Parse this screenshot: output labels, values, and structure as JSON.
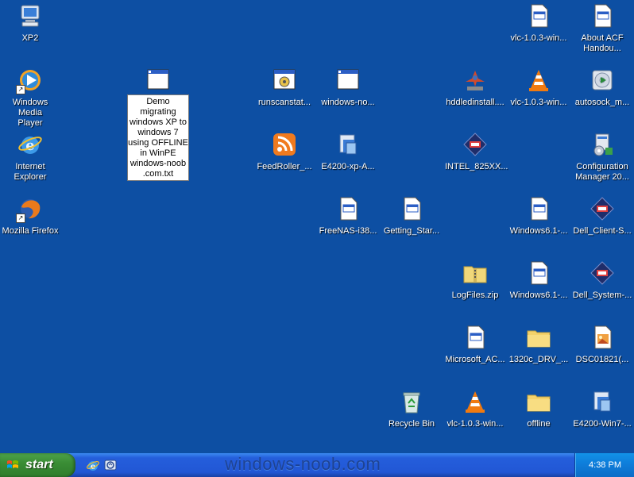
{
  "desktop": {
    "icons": [
      {
        "label": "XP2",
        "icon": "computer-icon"
      },
      {
        "label": "Windows Media\nPlayer",
        "icon": "media-player-icon"
      },
      {
        "label": "Internet\nExplorer",
        "icon": "ie-icon"
      },
      {
        "label": "Mozilla Firefox",
        "icon": "firefox-icon"
      },
      {
        "label": "Demo\nmigrating\nwindows XP to\nwindows 7\nusing OFFLINE\nin WinPE\nwindows-noob\n.com.txt",
        "icon": "text-file-icon"
      },
      {
        "label": "runscanstat...",
        "icon": "script-icon"
      },
      {
        "label": "windows-no...",
        "icon": "window-file-icon"
      },
      {
        "label": "FeedRoller_...",
        "icon": "rss-icon"
      },
      {
        "label": "E4200-xp-A...",
        "icon": "installer-icon"
      },
      {
        "label": "FreeNAS-i38...",
        "icon": "doc-file-icon"
      },
      {
        "label": "Getting_Star...",
        "icon": "doc-file-icon"
      },
      {
        "label": "vlc-1.0.3-win...",
        "icon": "doc-file-icon"
      },
      {
        "label": "About ACF\nHandou...",
        "icon": "doc-file-icon"
      },
      {
        "label": "hddledinstall....",
        "icon": "setup-icon"
      },
      {
        "label": "vlc-1.0.3-win...",
        "icon": "vlc-icon"
      },
      {
        "label": "autosock_m...",
        "icon": "disc-icon"
      },
      {
        "label": "INTEL_825XX...",
        "icon": "dell-setup-icon"
      },
      {
        "label": "Configuration\nManager 20...",
        "icon": "config-manager-icon"
      },
      {
        "label": "Windows6.1-...",
        "icon": "doc-file-icon"
      },
      {
        "label": "Dell_Client-S...",
        "icon": "dell-setup-icon"
      },
      {
        "label": "LogFiles.zip",
        "icon": "zip-folder-icon"
      },
      {
        "label": "Windows6.1-...",
        "icon": "doc-file-icon"
      },
      {
        "label": "Dell_System-...",
        "icon": "dell-setup-icon"
      },
      {
        "label": "Microsoft_AC...",
        "icon": "doc-file-icon"
      },
      {
        "label": "1320c_DRV_...",
        "icon": "folder-icon"
      },
      {
        "label": "DSC01821(...",
        "icon": "image-file-icon"
      },
      {
        "label": "Recycle Bin",
        "icon": "recycle-bin-icon"
      },
      {
        "label": "vlc-1.0.3-win...",
        "icon": "vlc-icon"
      },
      {
        "label": "offline",
        "icon": "folder-icon"
      },
      {
        "label": "E4200-Win7-...",
        "icon": "installer-icon"
      }
    ]
  },
  "taskbar": {
    "start_label": "start",
    "watermark": "windows-noob.com",
    "clock": "4:38 PM"
  }
}
